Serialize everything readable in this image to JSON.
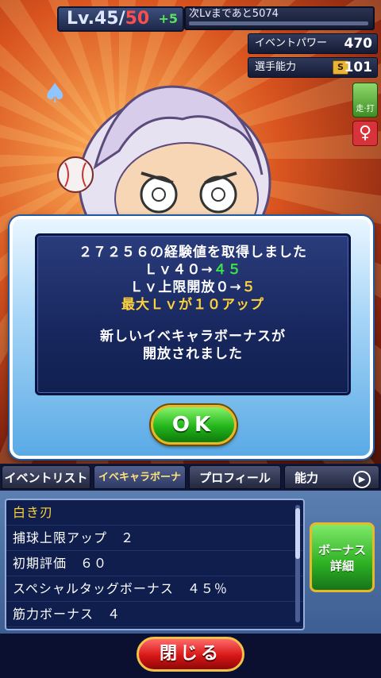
{
  "status": {
    "lv_prefix": "Lv.",
    "lv_current": "45",
    "lv_separator": "/",
    "lv_max": "50",
    "lv_plus": "+5",
    "next_lv_label": "次Lvまであと5074"
  },
  "stats": [
    {
      "label": "イベントパワー",
      "value": "470"
    },
    {
      "label": "選手能力",
      "rank": "S",
      "value": "101"
    }
  ],
  "side_icons": {
    "position_label": "走·打",
    "gender_symbol": "♀"
  },
  "dialog": {
    "lines": [
      {
        "text": "２７２５６の経験値を取得しました"
      },
      {
        "prefix": "Ｌｖ４０→",
        "highlight": "４５"
      },
      {
        "prefix": "Ｌｖ上限開放０→",
        "highlight": "５"
      },
      {
        "text": "最大Ｌｖが１０アップ"
      },
      {
        "text": "新しいイベキャラボーナスが"
      },
      {
        "text": "開放されました"
      }
    ],
    "ok_label": "OK"
  },
  "tabs": [
    {
      "label": "イベントリスト"
    },
    {
      "label": "イベキャラボーナス"
    },
    {
      "label": "プロフィール"
    },
    {
      "label": "能力"
    }
  ],
  "bonus_list": {
    "items": [
      {
        "text": "白き刃"
      },
      {
        "text": "捕球上限アップ　２"
      },
      {
        "text": "初期評価　６０"
      },
      {
        "text": "スペシャルタッグボーナス　４５％"
      },
      {
        "text": "筋力ボーナス　４"
      }
    ]
  },
  "bonus_detail_label_1": "ボーナス",
  "bonus_detail_label_2": "詳細",
  "close_label": "閉じる"
}
